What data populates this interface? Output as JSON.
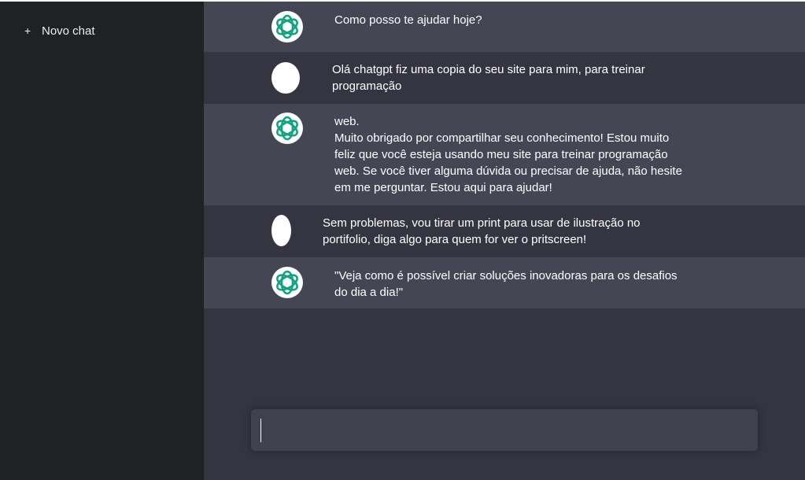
{
  "sidebar": {
    "new_chat_label": "Novo chat",
    "new_chat_icon": "+"
  },
  "messages": [
    {
      "role": "assistant",
      "avatar": "openai-logo-icon",
      "text": "Como posso te ajudar hoje?"
    },
    {
      "role": "user",
      "avatar": "user-avatar",
      "text": "Olá chatgpt fiz uma copia do seu site para mim, para treinar\nprogramação"
    },
    {
      "role": "assistant",
      "avatar": "openai-logo-icon",
      "text": "web.\nMuito obrigado por compartilhar seu conhecimento! Estou muito\nfeliz que você esteja usando meu site para treinar programação\nweb. Se você tiver alguma dúvida ou precisar de ajuda, não hesite\nem me perguntar. Estou aqui para ajudar!"
    },
    {
      "role": "user",
      "avatar": "user-avatar",
      "text": "Sem problemas, vou tirar um print para usar de ilustração no\nportifolio, diga algo para quem for ver o pritscreen!"
    },
    {
      "role": "assistant",
      "avatar": "openai-logo-icon",
      "text": "\"Veja como é possível criar soluções inovadoras para os desafios\ndo dia a dia!\""
    }
  ],
  "composer": {
    "value": "",
    "placeholder": ""
  },
  "colors": {
    "sidebar_bg": "#202123",
    "main_bg": "#343541",
    "assistant_row_bg": "#444654",
    "composer_bg": "#40414f",
    "openai_green": "#10a37f"
  }
}
